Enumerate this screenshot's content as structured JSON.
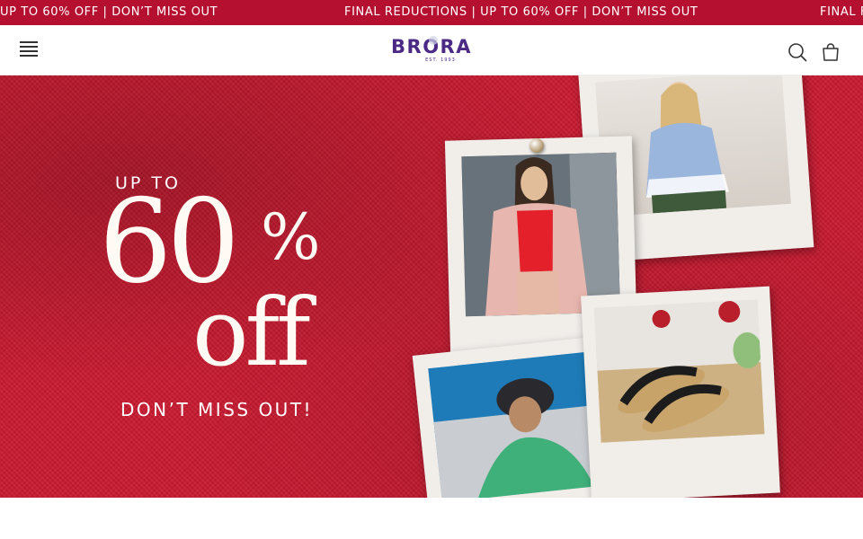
{
  "announcement": {
    "text_left": "UP TO 60% OFF | DON’T MISS OUT",
    "text_center": "FINAL REDUCTIONS | UP TO 60% OFF | DON’T MISS OUT",
    "text_right": "FINAL F"
  },
  "header": {
    "logo_text": "BRORA",
    "logo_est": "EST.    1993",
    "icons": [
      "menu-icon",
      "search-icon",
      "shopping-bag-icon"
    ]
  },
  "hero": {
    "eyebrow": "UP TO",
    "number": "60",
    "percent": "%",
    "off": "off",
    "cta": "DON’T MISS OUT!"
  },
  "colors": {
    "banner_red": "#b5102f",
    "hero_red": "#c8192f",
    "logo_purple": "#4b2a86"
  }
}
